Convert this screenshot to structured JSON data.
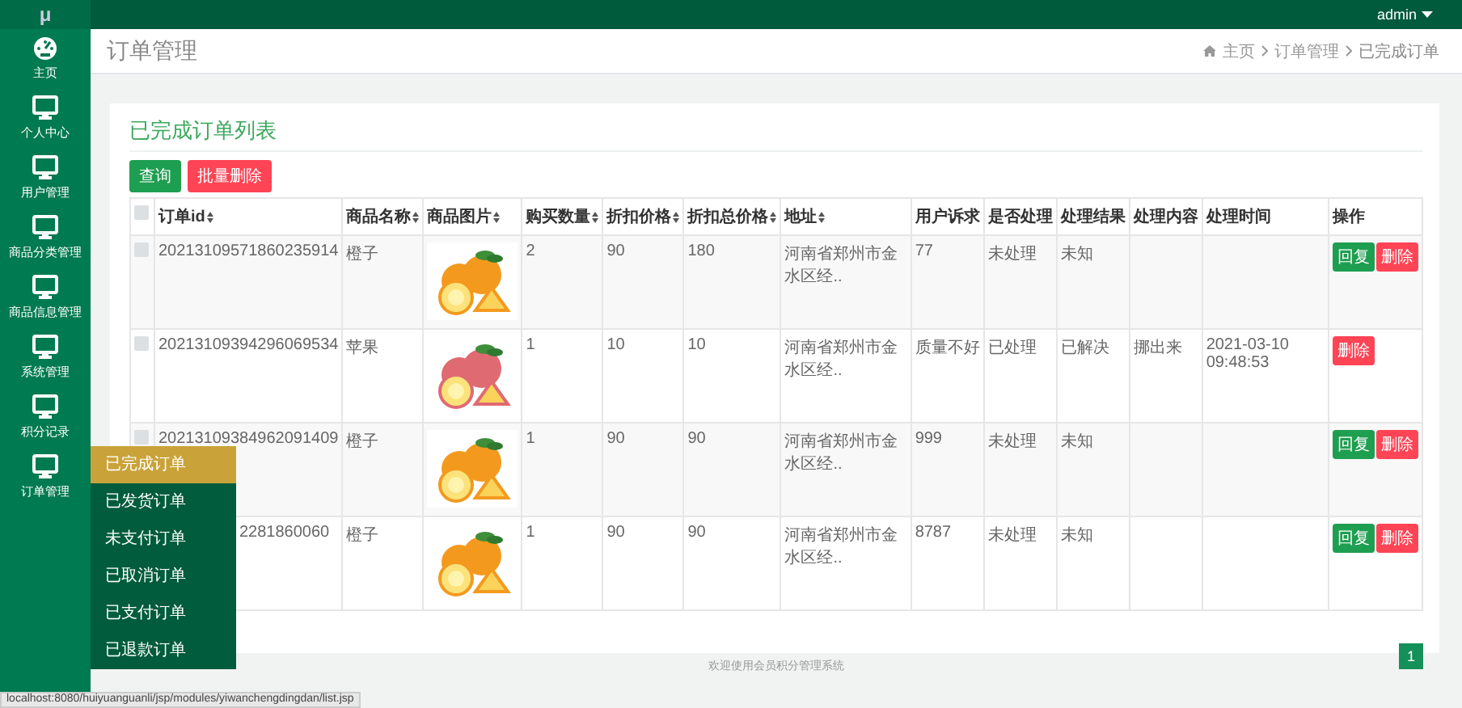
{
  "app": {
    "logo": "μ",
    "user": "admin"
  },
  "sidebar": {
    "items": [
      {
        "label": "主页",
        "kind": "dashboard"
      },
      {
        "label": "个人中心",
        "kind": "monitor"
      },
      {
        "label": "用户管理",
        "kind": "monitor"
      },
      {
        "label": "商品分类管理",
        "kind": "monitor"
      },
      {
        "label": "商品信息管理",
        "kind": "monitor"
      },
      {
        "label": "系统管理",
        "kind": "monitor"
      },
      {
        "label": "积分记录",
        "kind": "monitor"
      },
      {
        "label": "订单管理",
        "kind": "monitor"
      }
    ]
  },
  "submenu": {
    "items": [
      {
        "label": "已完成订单",
        "selected": true
      },
      {
        "label": "已发货订单",
        "selected": false
      },
      {
        "label": "未支付订单",
        "selected": false
      },
      {
        "label": "已取消订单",
        "selected": false
      },
      {
        "label": "已支付订单",
        "selected": false
      },
      {
        "label": "已退款订单",
        "selected": false
      }
    ]
  },
  "page": {
    "title": "订单管理",
    "breadcrumb": [
      "主页",
      "订单管理",
      "已完成订单"
    ]
  },
  "card": {
    "title": "已完成订单列表",
    "buttons": [
      {
        "label": "查询",
        "kind": "primary"
      },
      {
        "label": "批量删除",
        "kind": "danger"
      }
    ]
  },
  "table": {
    "header_checked": false,
    "columns": [
      {
        "label": "订单id",
        "sortable": true
      },
      {
        "label": "商品名称",
        "sortable": true
      },
      {
        "label": "商品图片",
        "sortable": true
      },
      {
        "label": "购买数量",
        "sortable": true
      },
      {
        "label": "折扣价格",
        "sortable": true
      },
      {
        "label": "折扣总价格",
        "sortable": true
      },
      {
        "label": "地址",
        "sortable": true
      },
      {
        "label": "用户诉求",
        "sortable": false
      },
      {
        "label": "是否处理",
        "sortable": false
      },
      {
        "label": "处理结果",
        "sortable": false
      },
      {
        "label": "处理内容",
        "sortable": false
      },
      {
        "label": "处理时间",
        "sortable": false
      },
      {
        "label": "操作",
        "sortable": false
      }
    ],
    "rows": [
      {
        "checked": false,
        "id": "20213109571860235914",
        "name": "橙子",
        "image": {
          "kind": "picture",
          "color": "#f39a1e"
        },
        "qty": "2",
        "price": "90",
        "total": "180",
        "address": "河南省郑州市金水区经..",
        "request": "77",
        "status": "未处理",
        "result": "未知",
        "actions": [
          {
            "label": "回复",
            "kind": "reply"
          },
          {
            "label": "删除",
            "kind": "delete"
          }
        ]
      },
      {
        "checked": false,
        "id": "20213109394296069534",
        "name": "苹果",
        "image": {
          "kind": "picture",
          "color": "#e06a72"
        },
        "qty": "1",
        "price": "10",
        "total": "10",
        "address": "河南省郑州市金水区经..",
        "request": "质量不好",
        "status": "已处理",
        "result": "已解决",
        "content": "挪出来",
        "time": "2021-03-10 09:48:53",
        "actions": [
          {
            "label": "删除",
            "kind": "delete"
          }
        ]
      },
      {
        "checked": false,
        "id": "20213109384962091409",
        "name": "橙子",
        "image": {
          "kind": "picture",
          "color": "#f39a1e"
        },
        "qty": "1",
        "price": "90",
        "total": "90",
        "address": "河南省郑州市金水区经..",
        "request": "999",
        "status": "未处理",
        "result": "未知",
        "actions": [
          {
            "label": "回复",
            "kind": "reply"
          },
          {
            "label": "删除",
            "kind": "delete"
          }
        ]
      },
      {
        "partly_hidden": true,
        "id": "2281860060",
        "name": "橙子",
        "image": {
          "kind": "picture",
          "color": "#f39a1e"
        },
        "qty": "1",
        "price": "90",
        "total": "90",
        "address": "河南省郑州市金水区经..",
        "request": "8787",
        "status": "未处理",
        "result": "未知",
        "actions": [
          {
            "label": "回复",
            "kind": "reply"
          },
          {
            "label": "删除",
            "kind": "delete"
          }
        ]
      }
    ]
  },
  "pagination": {
    "pages": [
      {
        "label": "1",
        "selected": true
      }
    ]
  },
  "footer": "欢迎使用会员积分管理系统",
  "status_bar": {
    "url": "localhost:8080/huiyuanguanli/jsp/modules/yiwanchengdingdan/list.jsp"
  }
}
